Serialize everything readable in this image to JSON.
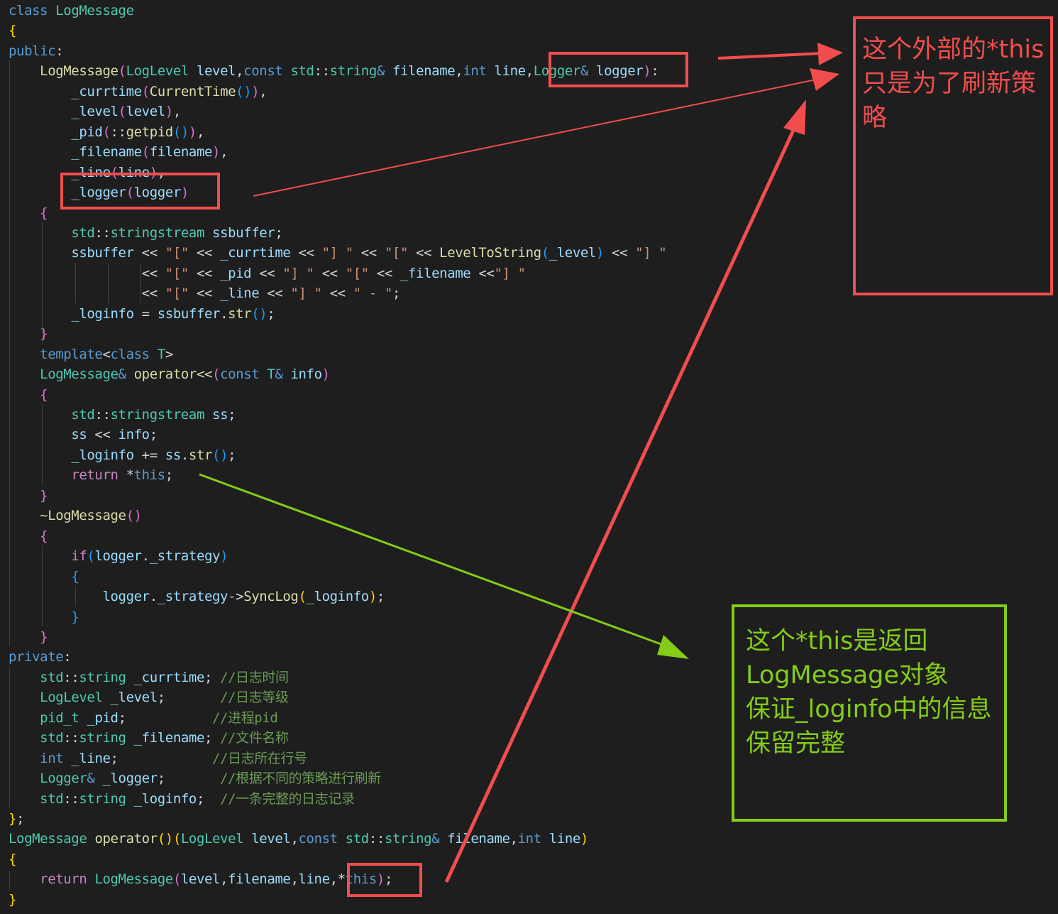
{
  "code": {
    "token_colors": {
      "k": "#569cd6",
      "c": "#c586c0",
      "t": "#4ec9b0",
      "f": "#dcdcaa",
      "v": "#9cdcfe",
      "s": "#ce9178",
      "m": "#6a9955",
      "p": "#d4d4d4",
      "y": "#ffd700",
      "q": "#da70d6",
      "b": "#179fff"
    },
    "lines": [
      [
        [
          "k",
          "class"
        ],
        [
          "p",
          " "
        ],
        [
          "t",
          "LogMessage"
        ]
      ],
      [
        [
          "y",
          "{"
        ]
      ],
      [
        [
          "k",
          "public"
        ],
        [
          "p",
          ":"
        ]
      ],
      [
        [
          "p",
          "    "
        ],
        [
          "f",
          "LogMessage"
        ],
        [
          "q",
          "("
        ],
        [
          "t",
          "LogLevel"
        ],
        [
          "p",
          " "
        ],
        [
          "v",
          "level"
        ],
        [
          "p",
          ","
        ],
        [
          "k",
          "const"
        ],
        [
          "p",
          " "
        ],
        [
          "t",
          "std"
        ],
        [
          "p",
          "::"
        ],
        [
          "t",
          "string"
        ],
        [
          "k",
          "&"
        ],
        [
          "p",
          " "
        ],
        [
          "v",
          "filename"
        ],
        [
          "p",
          ","
        ],
        [
          "k",
          "int"
        ],
        [
          "p",
          " "
        ],
        [
          "v",
          "line"
        ],
        [
          "p",
          ","
        ],
        [
          "t",
          "Logger"
        ],
        [
          "k",
          "&"
        ],
        [
          "p",
          " "
        ],
        [
          "v",
          "logger"
        ],
        [
          "q",
          ")"
        ],
        [
          "p",
          ":"
        ]
      ],
      [
        [
          "p",
          "        "
        ],
        [
          "v",
          "_currtime"
        ],
        [
          "q",
          "("
        ],
        [
          "f",
          "CurrentTime"
        ],
        [
          "b",
          "()"
        ],
        [
          "q",
          ")"
        ],
        [
          "p",
          ","
        ]
      ],
      [
        [
          "p",
          "        "
        ],
        [
          "v",
          "_level"
        ],
        [
          "q",
          "("
        ],
        [
          "v",
          "level"
        ],
        [
          "q",
          ")"
        ],
        [
          "p",
          ","
        ]
      ],
      [
        [
          "p",
          "        "
        ],
        [
          "v",
          "_pid"
        ],
        [
          "q",
          "("
        ],
        [
          "p",
          "::"
        ],
        [
          "f",
          "getpid"
        ],
        [
          "b",
          "()"
        ],
        [
          "q",
          ")"
        ],
        [
          "p",
          ","
        ]
      ],
      [
        [
          "p",
          "        "
        ],
        [
          "v",
          "_filename"
        ],
        [
          "q",
          "("
        ],
        [
          "v",
          "filename"
        ],
        [
          "q",
          ")"
        ],
        [
          "p",
          ","
        ]
      ],
      [
        [
          "p",
          "        "
        ],
        [
          "v",
          "_line"
        ],
        [
          "q",
          "("
        ],
        [
          "v",
          "line"
        ],
        [
          "q",
          ")"
        ],
        [
          "p",
          ","
        ]
      ],
      [
        [
          "p",
          "        "
        ],
        [
          "v",
          "_logger"
        ],
        [
          "q",
          "("
        ],
        [
          "v",
          "logger"
        ],
        [
          "q",
          ")"
        ]
      ],
      [
        [
          "p",
          "    "
        ],
        [
          "q",
          "{"
        ]
      ],
      [
        [
          "p",
          "        "
        ],
        [
          "t",
          "std"
        ],
        [
          "p",
          "::"
        ],
        [
          "t",
          "stringstream"
        ],
        [
          "p",
          " "
        ],
        [
          "v",
          "ssbuffer"
        ],
        [
          "p",
          ";"
        ]
      ],
      [
        [
          "p",
          "        "
        ],
        [
          "v",
          "ssbuffer"
        ],
        [
          "p",
          " << "
        ],
        [
          "s",
          "\"[\""
        ],
        [
          "p",
          " << "
        ],
        [
          "v",
          "_currtime"
        ],
        [
          "p",
          " << "
        ],
        [
          "s",
          "\"] \""
        ],
        [
          "p",
          " << "
        ],
        [
          "s",
          "\"[\""
        ],
        [
          "p",
          " << "
        ],
        [
          "f",
          "LevelToString"
        ],
        [
          "b",
          "("
        ],
        [
          "v",
          "_level"
        ],
        [
          "b",
          ")"
        ],
        [
          "p",
          " << "
        ],
        [
          "s",
          "\"] \""
        ]
      ],
      [
        [
          "p",
          "                 << "
        ],
        [
          "s",
          "\"[\""
        ],
        [
          "p",
          " << "
        ],
        [
          "v",
          "_pid"
        ],
        [
          "p",
          " << "
        ],
        [
          "s",
          "\"] \""
        ],
        [
          "p",
          " << "
        ],
        [
          "s",
          "\"[\""
        ],
        [
          "p",
          " << "
        ],
        [
          "v",
          "_filename"
        ],
        [
          "p",
          " <<"
        ],
        [
          "s",
          "\"] \""
        ]
      ],
      [
        [
          "p",
          "                 << "
        ],
        [
          "s",
          "\"[\""
        ],
        [
          "p",
          " << "
        ],
        [
          "v",
          "_line"
        ],
        [
          "p",
          " << "
        ],
        [
          "s",
          "\"] \""
        ],
        [
          "p",
          " << "
        ],
        [
          "s",
          "\" - \""
        ],
        [
          "p",
          ";"
        ]
      ],
      [
        [
          "p",
          "        "
        ],
        [
          "v",
          "_loginfo"
        ],
        [
          "p",
          " = "
        ],
        [
          "v",
          "ssbuffer"
        ],
        [
          "p",
          "."
        ],
        [
          "f",
          "str"
        ],
        [
          "b",
          "()"
        ],
        [
          "p",
          ";"
        ]
      ],
      [
        [
          "p",
          "    "
        ],
        [
          "q",
          "}"
        ]
      ],
      [
        [
          "p",
          "    "
        ],
        [
          "k",
          "template"
        ],
        [
          "p",
          "<"
        ],
        [
          "k",
          "class"
        ],
        [
          "p",
          " "
        ],
        [
          "t",
          "T"
        ],
        [
          "p",
          ">"
        ]
      ],
      [
        [
          "p",
          "    "
        ],
        [
          "t",
          "LogMessage"
        ],
        [
          "k",
          "&"
        ],
        [
          "p",
          " "
        ],
        [
          "f",
          "operator<<"
        ],
        [
          "q",
          "("
        ],
        [
          "k",
          "const"
        ],
        [
          "p",
          " "
        ],
        [
          "t",
          "T"
        ],
        [
          "k",
          "&"
        ],
        [
          "p",
          " "
        ],
        [
          "v",
          "info"
        ],
        [
          "q",
          ")"
        ]
      ],
      [
        [
          "p",
          "    "
        ],
        [
          "q",
          "{"
        ]
      ],
      [
        [
          "p",
          "        "
        ],
        [
          "t",
          "std"
        ],
        [
          "p",
          "::"
        ],
        [
          "t",
          "stringstream"
        ],
        [
          "p",
          " "
        ],
        [
          "v",
          "ss"
        ],
        [
          "p",
          ";"
        ]
      ],
      [
        [
          "p",
          "        "
        ],
        [
          "v",
          "ss"
        ],
        [
          "p",
          " << "
        ],
        [
          "v",
          "info"
        ],
        [
          "p",
          ";"
        ]
      ],
      [
        [
          "p",
          "        "
        ],
        [
          "v",
          "_loginfo"
        ],
        [
          "p",
          " += "
        ],
        [
          "v",
          "ss"
        ],
        [
          "p",
          "."
        ],
        [
          "f",
          "str"
        ],
        [
          "b",
          "()"
        ],
        [
          "p",
          ";"
        ]
      ],
      [
        [
          "p",
          "        "
        ],
        [
          "c",
          "return"
        ],
        [
          "p",
          " *"
        ],
        [
          "k",
          "this"
        ],
        [
          "p",
          ";"
        ]
      ],
      [
        [
          "p",
          "    "
        ],
        [
          "q",
          "}"
        ]
      ],
      [
        [
          "p",
          "    "
        ],
        [
          "f",
          "~LogMessage"
        ],
        [
          "q",
          "()"
        ]
      ],
      [
        [
          "p",
          "    "
        ],
        [
          "q",
          "{"
        ]
      ],
      [
        [
          "p",
          "        "
        ],
        [
          "c",
          "if"
        ],
        [
          "b",
          "("
        ],
        [
          "v",
          "logger"
        ],
        [
          "p",
          "."
        ],
        [
          "v",
          "_strategy"
        ],
        [
          "b",
          ")"
        ]
      ],
      [
        [
          "p",
          "        "
        ],
        [
          "b",
          "{"
        ]
      ],
      [
        [
          "p",
          "            "
        ],
        [
          "v",
          "logger"
        ],
        [
          "p",
          "."
        ],
        [
          "v",
          "_strategy"
        ],
        [
          "p",
          "->"
        ],
        [
          "f",
          "SyncLog"
        ],
        [
          "y",
          "("
        ],
        [
          "v",
          "_loginfo"
        ],
        [
          "y",
          ")"
        ],
        [
          "p",
          ";"
        ]
      ],
      [
        [
          "p",
          "        "
        ],
        [
          "b",
          "}"
        ]
      ],
      [
        [
          "p",
          "    "
        ],
        [
          "q",
          "}"
        ]
      ],
      [
        [
          "k",
          "private"
        ],
        [
          "p",
          ":"
        ]
      ],
      [
        [
          "p",
          "    "
        ],
        [
          "t",
          "std"
        ],
        [
          "p",
          "::"
        ],
        [
          "t",
          "string"
        ],
        [
          "p",
          " "
        ],
        [
          "v",
          "_currtime"
        ],
        [
          "p",
          "; "
        ],
        [
          "m",
          "//日志时间"
        ]
      ],
      [
        [
          "p",
          "    "
        ],
        [
          "t",
          "LogLevel"
        ],
        [
          "p",
          " "
        ],
        [
          "v",
          "_level"
        ],
        [
          "p",
          ";       "
        ],
        [
          "m",
          "//日志等级"
        ]
      ],
      [
        [
          "p",
          "    "
        ],
        [
          "t",
          "pid_t"
        ],
        [
          "p",
          " "
        ],
        [
          "v",
          "_pid"
        ],
        [
          "p",
          ";           "
        ],
        [
          "m",
          "//进程pid"
        ]
      ],
      [
        [
          "p",
          "    "
        ],
        [
          "t",
          "std"
        ],
        [
          "p",
          "::"
        ],
        [
          "t",
          "string"
        ],
        [
          "p",
          " "
        ],
        [
          "v",
          "_filename"
        ],
        [
          "p",
          "; "
        ],
        [
          "m",
          "//文件名称"
        ]
      ],
      [
        [
          "p",
          "    "
        ],
        [
          "k",
          "int"
        ],
        [
          "p",
          " "
        ],
        [
          "v",
          "_line"
        ],
        [
          "p",
          ";            "
        ],
        [
          "m",
          "//日志所在行号"
        ]
      ],
      [
        [
          "p",
          "    "
        ],
        [
          "t",
          "Logger"
        ],
        [
          "k",
          "&"
        ],
        [
          "p",
          " "
        ],
        [
          "v",
          "_logger"
        ],
        [
          "p",
          ";       "
        ],
        [
          "m",
          "//根据不同的策略进行刷新"
        ]
      ],
      [
        [
          "p",
          "    "
        ],
        [
          "t",
          "std"
        ],
        [
          "p",
          "::"
        ],
        [
          "t",
          "string"
        ],
        [
          "p",
          " "
        ],
        [
          "v",
          "_loginfo"
        ],
        [
          "p",
          ";  "
        ],
        [
          "m",
          "//一条完整的日志记录"
        ]
      ],
      [
        [
          "y",
          "}"
        ],
        [
          "p",
          ";"
        ]
      ],
      [
        [
          "t",
          "LogMessage"
        ],
        [
          "p",
          " "
        ],
        [
          "f",
          "operator"
        ],
        [
          "y",
          "()"
        ],
        [
          "y",
          "("
        ],
        [
          "t",
          "LogLevel"
        ],
        [
          "p",
          " "
        ],
        [
          "v",
          "level"
        ],
        [
          "p",
          ","
        ],
        [
          "k",
          "const"
        ],
        [
          "p",
          " "
        ],
        [
          "t",
          "std"
        ],
        [
          "p",
          "::"
        ],
        [
          "t",
          "string"
        ],
        [
          "k",
          "&"
        ],
        [
          "p",
          " "
        ],
        [
          "v",
          "filename"
        ],
        [
          "p",
          ","
        ],
        [
          "k",
          "int"
        ],
        [
          "p",
          " "
        ],
        [
          "v",
          "line"
        ],
        [
          "y",
          ")"
        ]
      ],
      [
        [
          "y",
          "{"
        ]
      ],
      [
        [
          "p",
          "    "
        ],
        [
          "c",
          "return"
        ],
        [
          "p",
          " "
        ],
        [
          "t",
          "LogMessage"
        ],
        [
          "q",
          "("
        ],
        [
          "v",
          "level"
        ],
        [
          "p",
          ","
        ],
        [
          "v",
          "filename"
        ],
        [
          "p",
          ","
        ],
        [
          "v",
          "line"
        ],
        [
          "p",
          ","
        ],
        [
          "p",
          "*"
        ],
        [
          "k",
          "this"
        ],
        [
          "q",
          ")"
        ],
        [
          "p",
          ";"
        ]
      ],
      [
        [
          "y",
          "}"
        ]
      ]
    ]
  },
  "annotations": {
    "red_note": "这个外部的*this\n只是为了刷新策\n略",
    "green_note": "这个*this是返回\nLogMessage对象\n保证_loginfo中的信息\n保留完整",
    "red_color": "#f24d4d",
    "green_color": "#84cc16"
  }
}
